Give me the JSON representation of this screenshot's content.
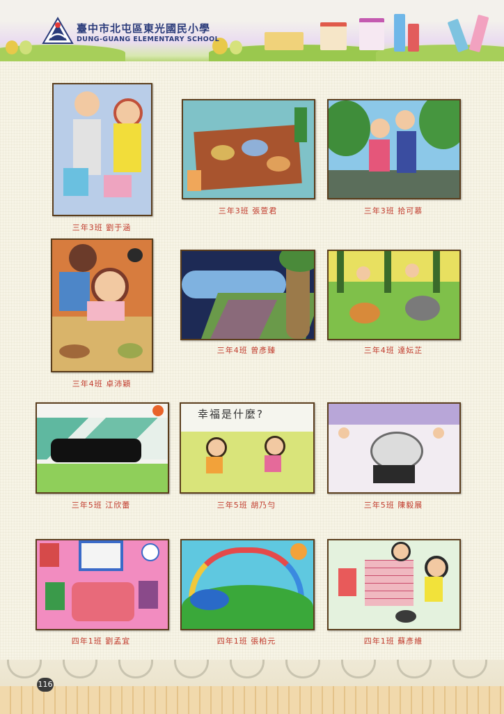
{
  "header": {
    "school_name_zh": "臺中市北屯區東光國民小學",
    "school_name_en": "DUNG-GUANG ELEMENTARY SCHOOL"
  },
  "gallery": {
    "artworks": [
      {
        "caption": "三年3班 劉于涵"
      },
      {
        "caption": "三年3班 張萱君"
      },
      {
        "caption": "三年3班 拾可慕"
      },
      {
        "caption": "三年4班 卓沛穎"
      },
      {
        "caption": "三年4班 曾彥臻"
      },
      {
        "caption": "三年4班 達妘芷"
      },
      {
        "caption": "三年5班 江欣蕾"
      },
      {
        "caption": "三年5班 胡乃勻"
      },
      {
        "caption": "三年5班 陳毅展"
      },
      {
        "caption": "四年1班 劉孟宜"
      },
      {
        "caption": "四年1班 張柏元"
      },
      {
        "caption": "四年1班 蘇彥維"
      }
    ],
    "drawing_texts": {
      "artwork_8_banner": "幸福是什麼?"
    }
  },
  "footer": {
    "page_number": "116"
  }
}
